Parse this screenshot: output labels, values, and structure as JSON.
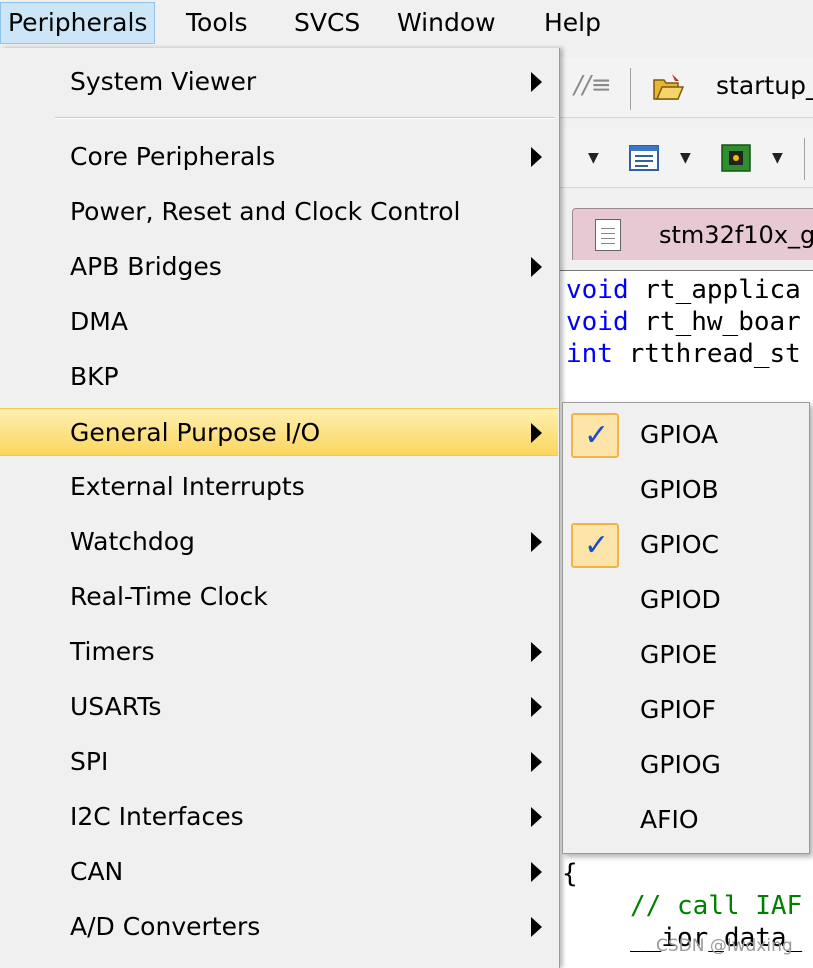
{
  "menubar": {
    "items": [
      {
        "label": "Peripherals"
      },
      {
        "label": "Tools"
      },
      {
        "label": "SVCS"
      },
      {
        "label": "Window"
      },
      {
        "label": "Help"
      }
    ]
  },
  "menu": {
    "items": [
      {
        "label": "System Viewer",
        "submenu": true
      },
      {
        "label": "Core Peripherals",
        "submenu": true
      },
      {
        "label": "Power, Reset and Clock Control",
        "submenu": false
      },
      {
        "label": "APB Bridges",
        "submenu": true
      },
      {
        "label": "DMA",
        "submenu": false
      },
      {
        "label": "BKP",
        "submenu": false
      },
      {
        "label": "General Purpose I/O",
        "submenu": true
      },
      {
        "label": "External Interrupts",
        "submenu": false
      },
      {
        "label": "Watchdog",
        "submenu": true
      },
      {
        "label": "Real-Time Clock",
        "submenu": false
      },
      {
        "label": "Timers",
        "submenu": true
      },
      {
        "label": "USARTs",
        "submenu": true
      },
      {
        "label": "SPI",
        "submenu": true
      },
      {
        "label": "I2C Interfaces",
        "submenu": true
      },
      {
        "label": "CAN",
        "submenu": true
      },
      {
        "label": "A/D Converters",
        "submenu": true
      }
    ]
  },
  "submenu": {
    "items": [
      {
        "label": "GPIOA",
        "checked": true
      },
      {
        "label": "GPIOB",
        "checked": false
      },
      {
        "label": "GPIOC",
        "checked": true
      },
      {
        "label": "GPIOD",
        "checked": false
      },
      {
        "label": "GPIOE",
        "checked": false
      },
      {
        "label": "GPIOF",
        "checked": false
      },
      {
        "label": "GPIOG",
        "checked": false
      },
      {
        "label": "AFIO",
        "checked": false
      }
    ],
    "check_glyph": "✓"
  },
  "toolbar": {
    "comment_glyph": "//≡",
    "file_label": "startup_"
  },
  "editor": {
    "tab_label": "stm32f10x_g",
    "lines": [
      {
        "kw": "void",
        "rest": " rt_applica"
      },
      {
        "kw": "void",
        "rest": " rt_hw_boar"
      },
      {
        "kw": "int",
        "rest": " rtthread_st"
      }
    ],
    "brace": "{",
    "comment": "// call IAF",
    "line_bottom": "__ior_data_"
  },
  "watermark": "CSDN @lwdxing",
  "colors": {
    "highlight": "#fbd65e",
    "menu_bg": "#f0f0f0",
    "keyword": "#0000ff",
    "comment": "#008000",
    "check": "#1a4fc9",
    "tab": "#e7c9d4"
  }
}
